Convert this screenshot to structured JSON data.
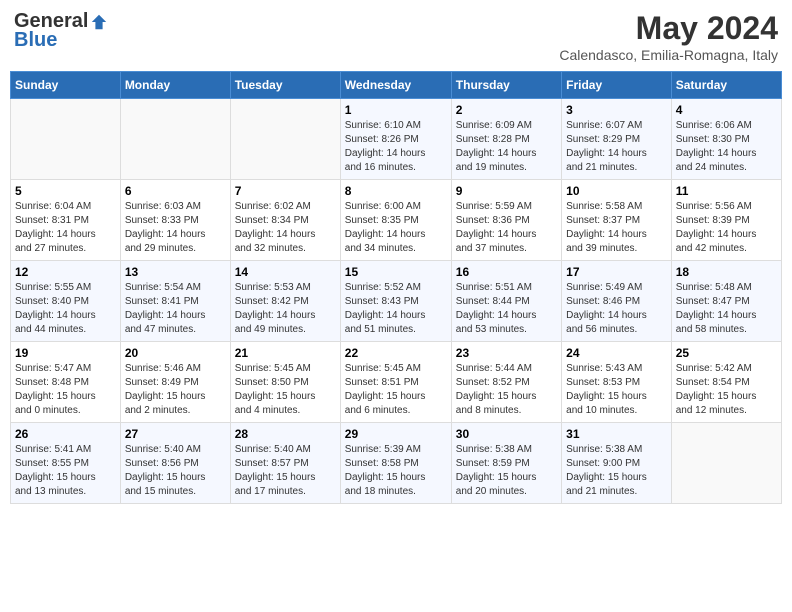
{
  "header": {
    "logo_general": "General",
    "logo_blue": "Blue",
    "month": "May 2024",
    "location": "Calendasco, Emilia-Romagna, Italy"
  },
  "days_of_week": [
    "Sunday",
    "Monday",
    "Tuesday",
    "Wednesday",
    "Thursday",
    "Friday",
    "Saturday"
  ],
  "weeks": [
    [
      {
        "num": "",
        "info": ""
      },
      {
        "num": "",
        "info": ""
      },
      {
        "num": "",
        "info": ""
      },
      {
        "num": "1",
        "info": "Sunrise: 6:10 AM\nSunset: 8:26 PM\nDaylight: 14 hours\nand 16 minutes."
      },
      {
        "num": "2",
        "info": "Sunrise: 6:09 AM\nSunset: 8:28 PM\nDaylight: 14 hours\nand 19 minutes."
      },
      {
        "num": "3",
        "info": "Sunrise: 6:07 AM\nSunset: 8:29 PM\nDaylight: 14 hours\nand 21 minutes."
      },
      {
        "num": "4",
        "info": "Sunrise: 6:06 AM\nSunset: 8:30 PM\nDaylight: 14 hours\nand 24 minutes."
      }
    ],
    [
      {
        "num": "5",
        "info": "Sunrise: 6:04 AM\nSunset: 8:31 PM\nDaylight: 14 hours\nand 27 minutes."
      },
      {
        "num": "6",
        "info": "Sunrise: 6:03 AM\nSunset: 8:33 PM\nDaylight: 14 hours\nand 29 minutes."
      },
      {
        "num": "7",
        "info": "Sunrise: 6:02 AM\nSunset: 8:34 PM\nDaylight: 14 hours\nand 32 minutes."
      },
      {
        "num": "8",
        "info": "Sunrise: 6:00 AM\nSunset: 8:35 PM\nDaylight: 14 hours\nand 34 minutes."
      },
      {
        "num": "9",
        "info": "Sunrise: 5:59 AM\nSunset: 8:36 PM\nDaylight: 14 hours\nand 37 minutes."
      },
      {
        "num": "10",
        "info": "Sunrise: 5:58 AM\nSunset: 8:37 PM\nDaylight: 14 hours\nand 39 minutes."
      },
      {
        "num": "11",
        "info": "Sunrise: 5:56 AM\nSunset: 8:39 PM\nDaylight: 14 hours\nand 42 minutes."
      }
    ],
    [
      {
        "num": "12",
        "info": "Sunrise: 5:55 AM\nSunset: 8:40 PM\nDaylight: 14 hours\nand 44 minutes."
      },
      {
        "num": "13",
        "info": "Sunrise: 5:54 AM\nSunset: 8:41 PM\nDaylight: 14 hours\nand 47 minutes."
      },
      {
        "num": "14",
        "info": "Sunrise: 5:53 AM\nSunset: 8:42 PM\nDaylight: 14 hours\nand 49 minutes."
      },
      {
        "num": "15",
        "info": "Sunrise: 5:52 AM\nSunset: 8:43 PM\nDaylight: 14 hours\nand 51 minutes."
      },
      {
        "num": "16",
        "info": "Sunrise: 5:51 AM\nSunset: 8:44 PM\nDaylight: 14 hours\nand 53 minutes."
      },
      {
        "num": "17",
        "info": "Sunrise: 5:49 AM\nSunset: 8:46 PM\nDaylight: 14 hours\nand 56 minutes."
      },
      {
        "num": "18",
        "info": "Sunrise: 5:48 AM\nSunset: 8:47 PM\nDaylight: 14 hours\nand 58 minutes."
      }
    ],
    [
      {
        "num": "19",
        "info": "Sunrise: 5:47 AM\nSunset: 8:48 PM\nDaylight: 15 hours\nand 0 minutes."
      },
      {
        "num": "20",
        "info": "Sunrise: 5:46 AM\nSunset: 8:49 PM\nDaylight: 15 hours\nand 2 minutes."
      },
      {
        "num": "21",
        "info": "Sunrise: 5:45 AM\nSunset: 8:50 PM\nDaylight: 15 hours\nand 4 minutes."
      },
      {
        "num": "22",
        "info": "Sunrise: 5:45 AM\nSunset: 8:51 PM\nDaylight: 15 hours\nand 6 minutes."
      },
      {
        "num": "23",
        "info": "Sunrise: 5:44 AM\nSunset: 8:52 PM\nDaylight: 15 hours\nand 8 minutes."
      },
      {
        "num": "24",
        "info": "Sunrise: 5:43 AM\nSunset: 8:53 PM\nDaylight: 15 hours\nand 10 minutes."
      },
      {
        "num": "25",
        "info": "Sunrise: 5:42 AM\nSunset: 8:54 PM\nDaylight: 15 hours\nand 12 minutes."
      }
    ],
    [
      {
        "num": "26",
        "info": "Sunrise: 5:41 AM\nSunset: 8:55 PM\nDaylight: 15 hours\nand 13 minutes."
      },
      {
        "num": "27",
        "info": "Sunrise: 5:40 AM\nSunset: 8:56 PM\nDaylight: 15 hours\nand 15 minutes."
      },
      {
        "num": "28",
        "info": "Sunrise: 5:40 AM\nSunset: 8:57 PM\nDaylight: 15 hours\nand 17 minutes."
      },
      {
        "num": "29",
        "info": "Sunrise: 5:39 AM\nSunset: 8:58 PM\nDaylight: 15 hours\nand 18 minutes."
      },
      {
        "num": "30",
        "info": "Sunrise: 5:38 AM\nSunset: 8:59 PM\nDaylight: 15 hours\nand 20 minutes."
      },
      {
        "num": "31",
        "info": "Sunrise: 5:38 AM\nSunset: 9:00 PM\nDaylight: 15 hours\nand 21 minutes."
      },
      {
        "num": "",
        "info": ""
      }
    ]
  ]
}
